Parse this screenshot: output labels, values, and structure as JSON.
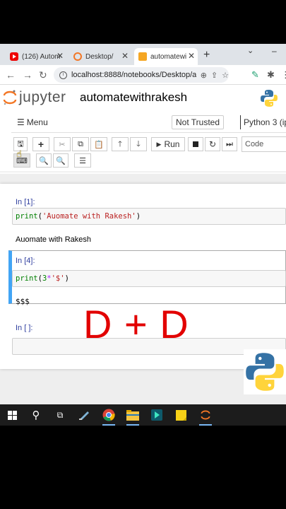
{
  "browser": {
    "tabs": [
      {
        "label": "(126) Autom",
        "icon": "youtube-icon"
      },
      {
        "label": "Desktop/",
        "icon": "jupyter-icon"
      },
      {
        "label": "automatewi",
        "icon": "notebook-icon"
      }
    ],
    "address": "localhost:8888/notebooks/Desktop/aut..."
  },
  "jupyter": {
    "brand": "jupyter",
    "notebook_title": "automatewithrakesh",
    "menu_label": "Menu",
    "trust_label": "Not Trusted",
    "kernel_label": "Python 3 (ip",
    "run_label": "Run",
    "cell_type": "Code"
  },
  "cells": [
    {
      "prompt": "In [1]:",
      "code_func": "print",
      "code_open": "(",
      "code_string": "'Auomate with Rakesh'",
      "code_close": ")",
      "output": "Auomate with Rakesh"
    },
    {
      "prompt": "In [4]:",
      "code_func": "print",
      "code_open": "(",
      "code_num": "3",
      "code_op": "*",
      "code_string": "'$'",
      "code_close": ")",
      "output": "$$$"
    },
    {
      "prompt": "In [ ]:"
    }
  ],
  "overlay_text": "D + D",
  "colors": {
    "overlay": "#e20000",
    "selected_cell_bar": "#42a5f5",
    "taskbar": "#1c1c1c"
  }
}
